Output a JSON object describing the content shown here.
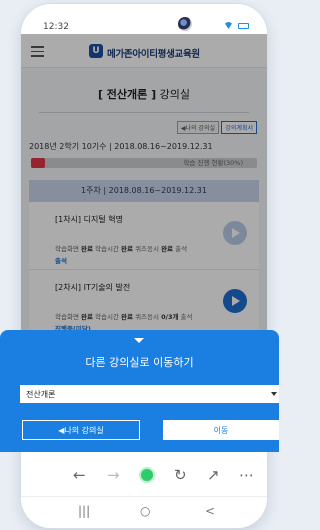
{
  "status_bar": {
    "time": "12:32"
  },
  "app": {
    "logo_mark": "U",
    "logo_text": "메가존아이티평생교육원",
    "page_title_bracket": "[ 전산개론 ]",
    "page_title_rest": "강의실",
    "mini_buttons": [
      "◀나의 강의실",
      "강의계획서"
    ],
    "term_info": "2018년 2학기 10기수 | 2018.08.16~2019.12.31",
    "progress_text": "학습 진행 현황(30%)",
    "progress_percent": 30,
    "week_header": "1주차 | 2018.08.16~2019.12.31",
    "lessons": [
      {
        "title": "[1차시] 디지털 혁명",
        "meta_parts": [
          "학습화면 ",
          "완료",
          " 학습시간 ",
          "완료",
          " 퀴즈응시 ",
          "완료",
          " 출석"
        ],
        "status": "출석"
      },
      {
        "title": "[2차시] IT기술의 발전",
        "meta_parts": [
          "학습화면 ",
          "완료",
          " 학습시간 ",
          "완료",
          " 퀴즈응시 ",
          "0/3개",
          " 출석"
        ],
        "status": "진행중(미달)"
      }
    ]
  },
  "sheet": {
    "title": "다른 강의실로 이동하기",
    "select_value": "전산개론",
    "my_classroom_label": "◀나의 강의실",
    "go_label": "이동"
  },
  "browser_nav": {
    "back": "←",
    "forward": "→",
    "refresh": "↻",
    "share": "↗",
    "more": "⋯"
  },
  "system_nav": {
    "recent": "|||",
    "home": "○",
    "back": "<"
  },
  "colors": {
    "accent": "#1a7fe0",
    "progress": "#e2354b",
    "home_dot": "#2fcc6b"
  }
}
